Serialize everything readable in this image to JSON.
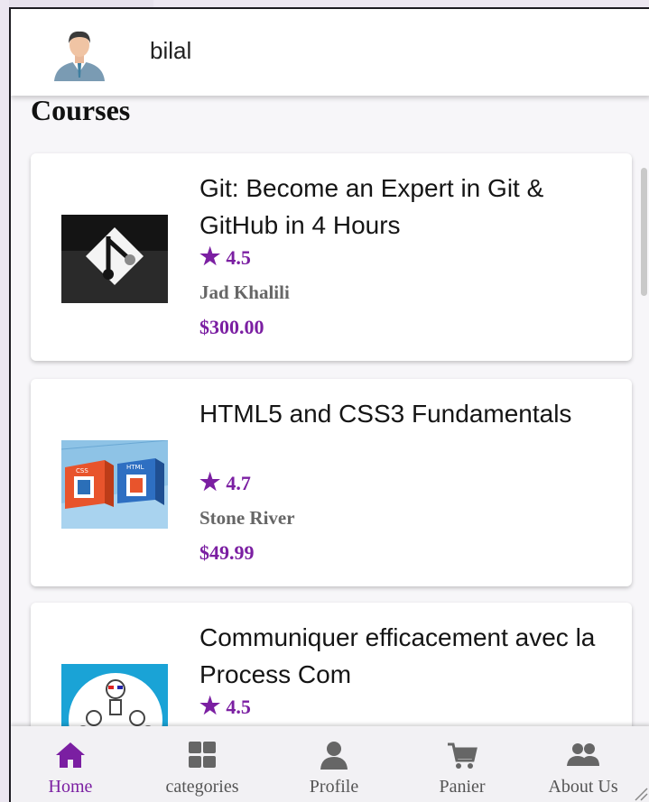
{
  "header": {
    "username": "bilal"
  },
  "section_title": "Courses",
  "courses": [
    {
      "title": "Git: Become an Expert in Git & GitHub in 4 Hours",
      "rating": "4.5",
      "author": "Jad Khalili",
      "price": "$300.00"
    },
    {
      "title": "HTML5 and CSS3 Fundamentals",
      "rating": "4.7",
      "author": "Stone River",
      "price": "$49.99"
    },
    {
      "title": "Communiquer efficacement avec la Process Com",
      "rating": "4.5"
    }
  ],
  "thumb_labels": {
    "css": "CSS",
    "html": "HTML"
  },
  "icons": {
    "star": "★"
  },
  "nav": [
    {
      "label": "Home",
      "icon": "home-icon",
      "active": true
    },
    {
      "label": "categories",
      "icon": "grid-icon"
    },
    {
      "label": "Profile",
      "icon": "person-icon"
    },
    {
      "label": "Panier",
      "icon": "cart-icon"
    },
    {
      "label": "About Us",
      "icon": "group-icon"
    }
  ],
  "colors": {
    "accent": "#7b1fa2",
    "author": "#666666",
    "nav_inactive": "#555555"
  }
}
